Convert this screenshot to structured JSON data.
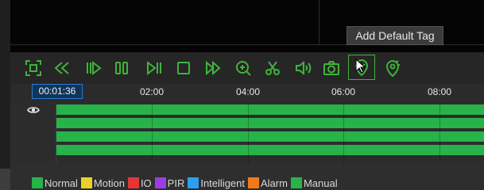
{
  "tooltip": {
    "text": "Add Default Tag"
  },
  "toolbar": {
    "accent_color": "#3fb33a",
    "buttons": [
      {
        "icon": "fullscreen-icon"
      },
      {
        "icon": "rewind-icon"
      },
      {
        "icon": "step-back-icon"
      },
      {
        "icon": "pause-icon"
      },
      {
        "icon": "step-forward-icon"
      },
      {
        "icon": "stop-icon"
      },
      {
        "icon": "fast-forward-icon"
      },
      {
        "icon": "zoom-in-icon"
      },
      {
        "icon": "clip-scissors-icon"
      },
      {
        "icon": "volume-icon"
      },
      {
        "icon": "snapshot-camera-icon"
      },
      {
        "icon": "add-default-tag-icon"
      },
      {
        "icon": "add-custom-tag-icon"
      }
    ]
  },
  "timeline": {
    "current_time": "00:01:36",
    "ticks": [
      "02:00",
      "04:00",
      "06:00",
      "08:00"
    ],
    "track_color": "#27b34a"
  },
  "legend": [
    {
      "label": "Normal",
      "color": "#27b34a"
    },
    {
      "label": "Motion",
      "color": "#e8d22a"
    },
    {
      "label": "IO",
      "color": "#e53535"
    },
    {
      "label": "PIR",
      "color": "#9c3ce6"
    },
    {
      "label": "Intelligent",
      "color": "#2c9ff0"
    },
    {
      "label": "Alarm",
      "color": "#f07a18"
    },
    {
      "label": "Manual",
      "color": "#27b34a"
    }
  ]
}
